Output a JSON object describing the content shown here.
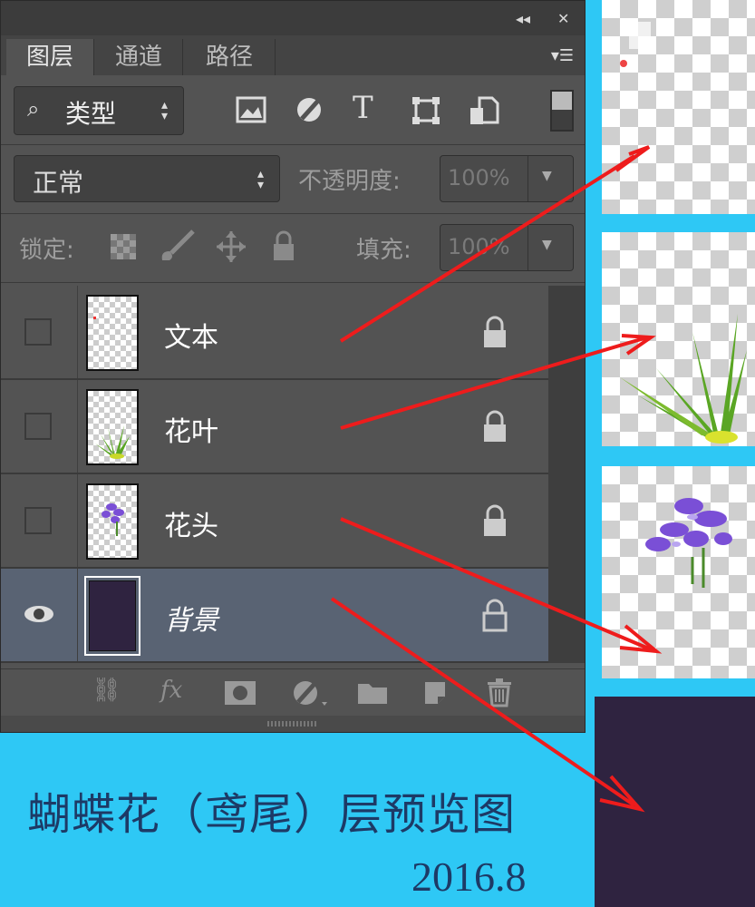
{
  "panel": {
    "tabs": [
      {
        "label": "图层",
        "active": true
      },
      {
        "label": "通道",
        "active": false
      },
      {
        "label": "路径",
        "active": false
      }
    ],
    "filter": {
      "icon": "search-icon",
      "value": "类型"
    },
    "filter_icons": [
      "image-filter-icon",
      "adjustment-filter-icon",
      "type-filter-icon",
      "shape-filter-icon",
      "smart-object-filter-icon"
    ],
    "blend_mode": "正常",
    "opacity_label": "不透明度:",
    "opacity_value": "100%",
    "lock_label": "锁定:",
    "fill_label": "填充:",
    "fill_value": "100%",
    "layers": [
      {
        "name": "文本",
        "visible": false,
        "locked": true,
        "active": false
      },
      {
        "name": "花叶",
        "visible": false,
        "locked": true,
        "active": false
      },
      {
        "name": "花头",
        "visible": false,
        "locked": true,
        "active": false
      },
      {
        "name": "背景",
        "visible": true,
        "locked": true,
        "active": true
      }
    ],
    "bottom_icons": [
      "link-icon",
      "fx-icon",
      "mask-icon",
      "adjustment-icon",
      "folder-icon",
      "new-layer-icon",
      "trash-icon"
    ]
  },
  "caption": {
    "title": "蝴蝶花（鸢尾）层预览图",
    "date": "2016.8"
  },
  "colors": {
    "background_layer": "#2f2340",
    "annotation_arrow": "#ee1c1c",
    "canvas_bg": "#2ec8f5",
    "panel_bg": "#535353"
  }
}
